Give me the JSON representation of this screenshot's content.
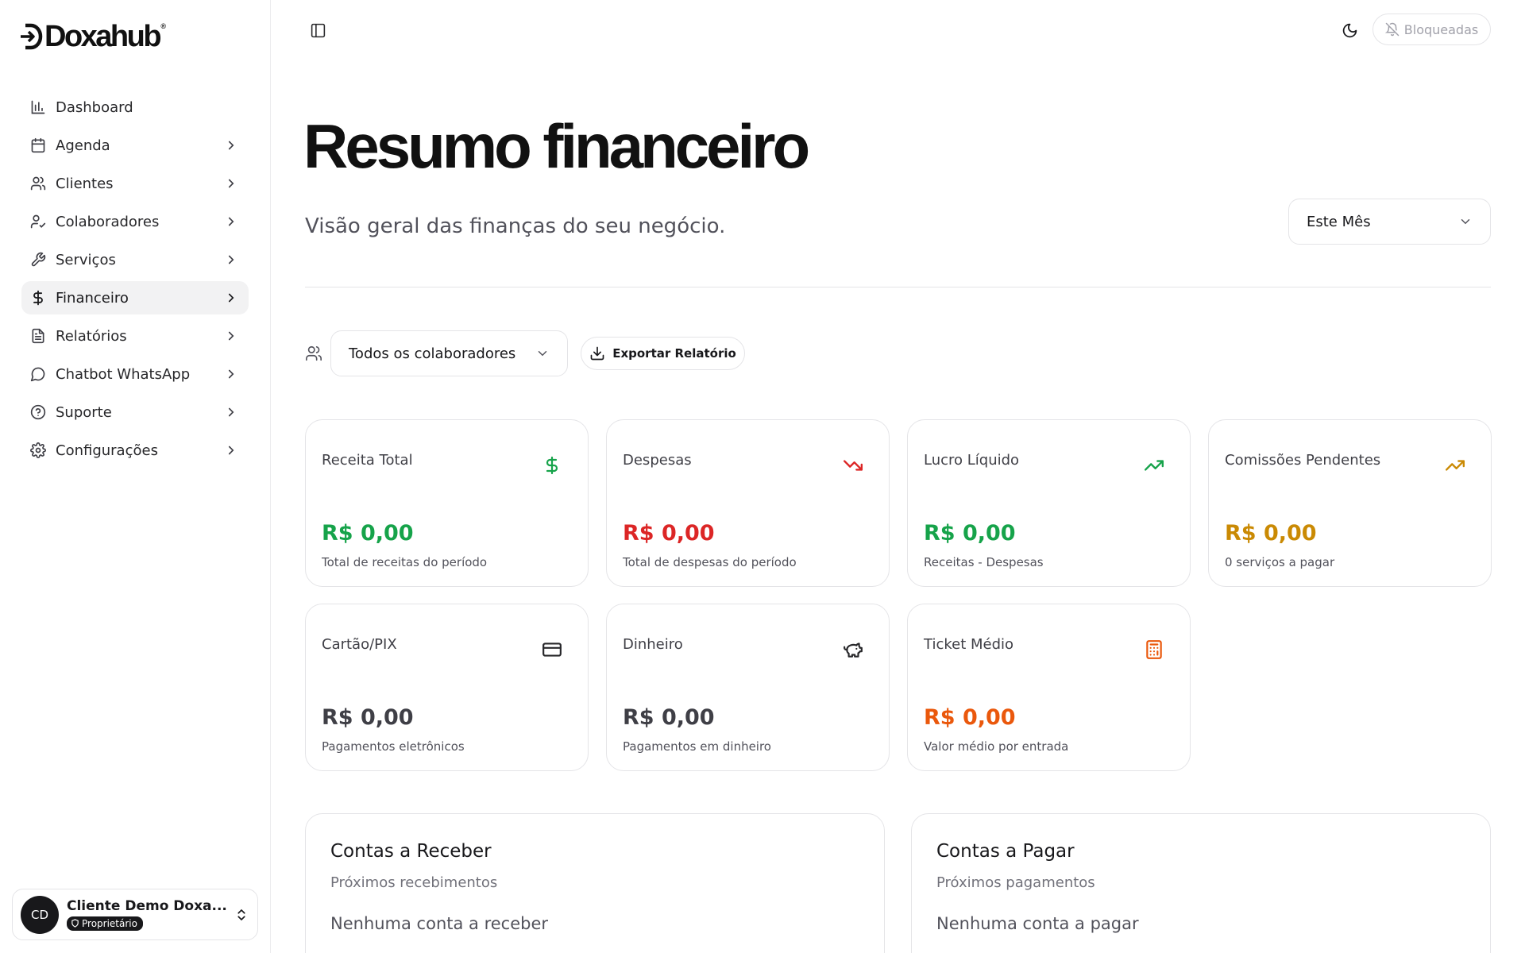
{
  "brand": {
    "name": "Doxahub",
    "mark": "®"
  },
  "sidebar": {
    "items": [
      {
        "label": "Dashboard",
        "icon": "bar-chart-icon",
        "active": false,
        "has_submenu": false
      },
      {
        "label": "Agenda",
        "icon": "calendar-icon",
        "active": false,
        "has_submenu": true
      },
      {
        "label": "Clientes",
        "icon": "users-icon",
        "active": false,
        "has_submenu": true
      },
      {
        "label": "Colaboradores",
        "icon": "user-check-icon",
        "active": false,
        "has_submenu": true
      },
      {
        "label": "Serviços",
        "icon": "wrench-icon",
        "active": false,
        "has_submenu": true
      },
      {
        "label": "Financeiro",
        "icon": "dollar-icon",
        "active": true,
        "has_submenu": true
      },
      {
        "label": "Relatórios",
        "icon": "file-text-icon",
        "active": false,
        "has_submenu": true
      },
      {
        "label": "Chatbot WhatsApp",
        "icon": "message-circle-icon",
        "active": false,
        "has_submenu": true
      },
      {
        "label": "Suporte",
        "icon": "help-circle-icon",
        "active": false,
        "has_submenu": true
      },
      {
        "label": "Configurações",
        "icon": "settings-icon",
        "active": false,
        "has_submenu": true
      }
    ]
  },
  "user": {
    "initials": "CD",
    "name": "Cliente Demo Doxa...",
    "role": "Proprietário"
  },
  "topbar": {
    "blocked_label": "Bloqueadas"
  },
  "header": {
    "title": "Resumo financeiro",
    "subtitle": "Visão geral das finanças do seu negócio.",
    "period": "Este Mês"
  },
  "filters": {
    "collaborator": "Todos os colaboradores",
    "export_label": "Exportar Relatório"
  },
  "colors": {
    "green": "#16a34a",
    "red": "#dc2626",
    "amber": "#ca8a04",
    "orange": "#ea580c",
    "neutral": "#3f3f46"
  },
  "stats": [
    {
      "label": "Receita Total",
      "value": "R$ 0,00",
      "desc": "Total de receitas do período",
      "icon": "dollar-icon",
      "color": "#16a34a"
    },
    {
      "label": "Despesas",
      "value": "R$ 0,00",
      "desc": "Total de despesas do período",
      "icon": "trending-down-icon",
      "color": "#dc2626"
    },
    {
      "label": "Lucro Líquido",
      "value": "R$ 0,00",
      "desc": "Receitas - Despesas",
      "icon": "trending-up-icon",
      "color": "#16a34a"
    },
    {
      "label": "Comissões Pendentes",
      "value": "R$ 0,00",
      "desc": "0 serviços a pagar",
      "icon": "trending-up-icon",
      "color": "#ca8a04"
    },
    {
      "label": "Cartão/PIX",
      "value": "R$ 0,00",
      "desc": "Pagamentos eletrônicos",
      "icon": "credit-card-icon",
      "color": "#3f3f46"
    },
    {
      "label": "Dinheiro",
      "value": "R$ 0,00",
      "desc": "Pagamentos em dinheiro",
      "icon": "piggy-bank-icon",
      "color": "#3f3f46"
    },
    {
      "label": "Ticket Médio",
      "value": "R$ 0,00",
      "desc": "Valor médio por entrada",
      "icon": "calculator-icon",
      "color": "#ea580c"
    }
  ],
  "panels": {
    "receivable": {
      "title": "Contas a Receber",
      "subtitle": "Próximos recebimentos",
      "empty": "Nenhuma conta a receber"
    },
    "payable": {
      "title": "Contas a Pagar",
      "subtitle": "Próximos pagamentos",
      "empty": "Nenhuma conta a pagar"
    }
  }
}
